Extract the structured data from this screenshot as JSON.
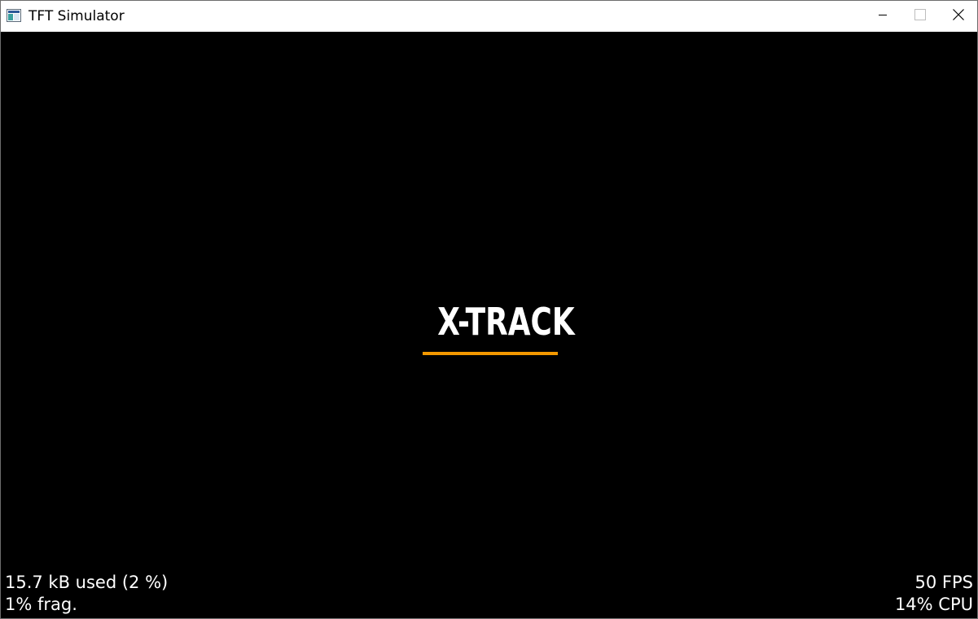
{
  "window": {
    "title": "TFT Simulator",
    "icon": "app-window-icon",
    "controls": {
      "minimize_icon": "minimize-icon",
      "maximize_icon": "maximize-icon",
      "close_icon": "close-icon"
    }
  },
  "screen": {
    "background": "#000000",
    "logo": {
      "text": "X-TRACK",
      "text_color": "#ffffff",
      "underline_color": "#f39800"
    },
    "memory_monitor": {
      "used": "15.7 kB used (2 %)",
      "fragmentation": "1% frag."
    },
    "performance_monitor": {
      "fps": "50 FPS",
      "cpu": "14% CPU"
    }
  }
}
